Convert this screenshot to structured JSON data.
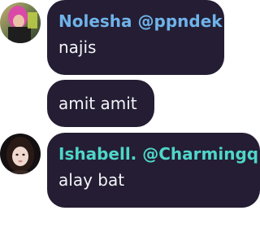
{
  "messages": [
    {
      "author": "Nolesha @ppndek",
      "text": "najis",
      "name_color": "#6fb3ea",
      "avatar": "user-photo-avatar"
    },
    {
      "author": "",
      "text": "amit amit"
    },
    {
      "author": "Ishabell. @Charmingq",
      "text": "alay bat",
      "name_color": "#4fd6c9",
      "avatar": "user-photo-avatar"
    }
  ],
  "colors": {
    "bubble": "#241d33",
    "background": "#ffffff"
  }
}
